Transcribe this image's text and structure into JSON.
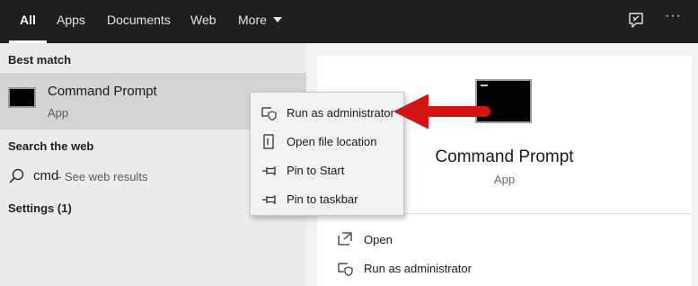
{
  "tabs": [
    {
      "label": "All",
      "active": true
    },
    {
      "label": "Apps"
    },
    {
      "label": "Documents"
    },
    {
      "label": "Web"
    },
    {
      "label": "More"
    }
  ],
  "topbar_icons": [
    "feedback-icon",
    "more-options-icon"
  ],
  "topbar_more_options": "···",
  "left": {
    "best_match_label": "Best match",
    "best_match_item": {
      "title": "Command Prompt",
      "subtitle": "App"
    },
    "search_web_label": "Search the web",
    "web_result": {
      "query": "cmd",
      "suffix": " - See web results"
    },
    "settings_label": "Settings (1)"
  },
  "context_menu": {
    "items": [
      {
        "label": "Run as administrator",
        "icon": "shield-icon"
      },
      {
        "label": "Open file location",
        "icon": "file-location-icon"
      },
      {
        "label": "Pin to Start",
        "icon": "pin-icon"
      },
      {
        "label": "Pin to taskbar",
        "icon": "pin-icon"
      }
    ]
  },
  "right": {
    "title": "Command Prompt",
    "subtitle": "App",
    "actions": [
      {
        "label": "Open",
        "icon": "open-icon"
      },
      {
        "label": "Run as administrator",
        "icon": "shield-icon"
      }
    ]
  },
  "colors": {
    "topbar_bg": "#1f1f1f",
    "left_bg": "#ebebeb",
    "highlight": "#d4d4d4",
    "arrow": "#e01010"
  }
}
